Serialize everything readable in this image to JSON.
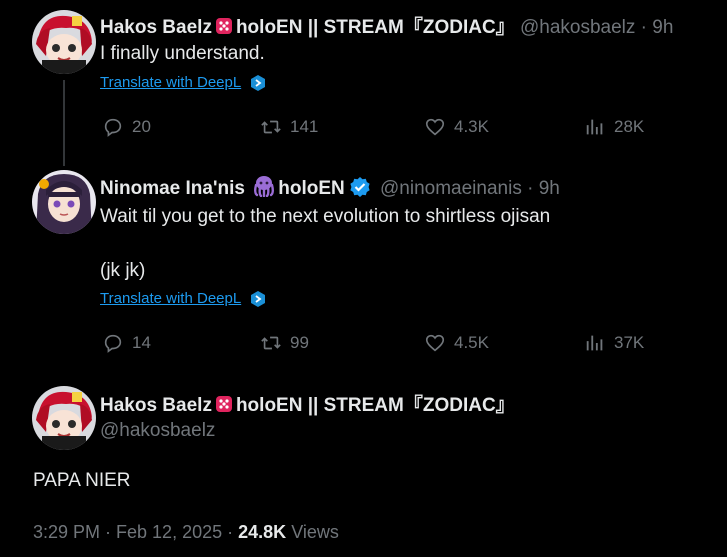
{
  "reply1": {
    "author_name": "Hakos Baelz",
    "author_suffix": "holoEN || STREAM『ZODIAC』",
    "handle": "@hakosbaelz",
    "time": "· 9h",
    "text": "I finally understand.",
    "translate_label": "Translate with DeepL",
    "replies": "20",
    "reposts": "141",
    "likes": "4.3K",
    "views": "28K"
  },
  "reply2": {
    "author_name": "Ninomae Ina'nis",
    "author_suffix": "holoEN",
    "handle": "@ninomaeinanis",
    "time": "· 9h",
    "text_line1": "Wait til you get to the next evolution to shirtless ojisan",
    "text_line2": "(jk jk)",
    "translate_label": "Translate with DeepL",
    "replies": "14",
    "reposts": "99",
    "likes": "4.5K",
    "views": "37K"
  },
  "main_tweet": {
    "author_name": "Hakos Baelz",
    "author_suffix": "holoEN || STREAM『ZODIAC』",
    "handle": "@hakosbaelz",
    "text": "PAPA NIER",
    "timestamp": "3:29 PM · Feb 12, 2025 ·",
    "view_count": "24.8K",
    "views_label": "Views"
  },
  "colors": {
    "background": "#000000",
    "text": "#e7e9ea",
    "muted": "#71767b",
    "link": "#1d9bf0",
    "verified": "#1d9bf0"
  }
}
